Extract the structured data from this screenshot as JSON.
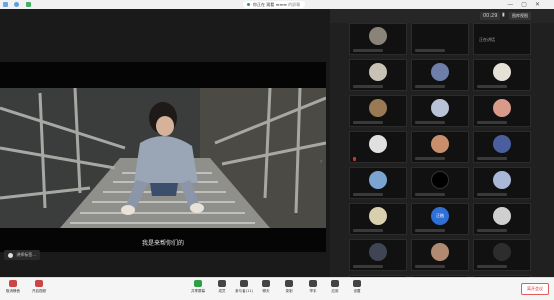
{
  "titlebar": {
    "recording_text": "你正在 观看",
    "recording_meta": "▬▬▬ 的屏幕"
  },
  "video": {
    "caption": "我是来帮你们的"
  },
  "speaker": {
    "name": "讲师标签..."
  },
  "panel": {
    "clock": "00:29",
    "gallery_label": "图库视图",
    "tile_text": "正在讲话",
    "tile_label_blue": "正楷"
  },
  "toolbar": {
    "items": [
      {
        "label": "取消静音"
      },
      {
        "label": "开启视频"
      },
      {
        "label": "共享屏幕"
      },
      {
        "label": "成员"
      },
      {
        "label": "参与者(11)"
      },
      {
        "label": "聊天"
      },
      {
        "label": "录制"
      },
      {
        "label": "举手"
      },
      {
        "label": "应用"
      },
      {
        "label": "设置"
      }
    ],
    "leave_label": "离开会议"
  },
  "colors": {
    "recording_dot": "#2ea043",
    "leave": "#d33333",
    "avatar_blue": "#2f6fd6"
  }
}
